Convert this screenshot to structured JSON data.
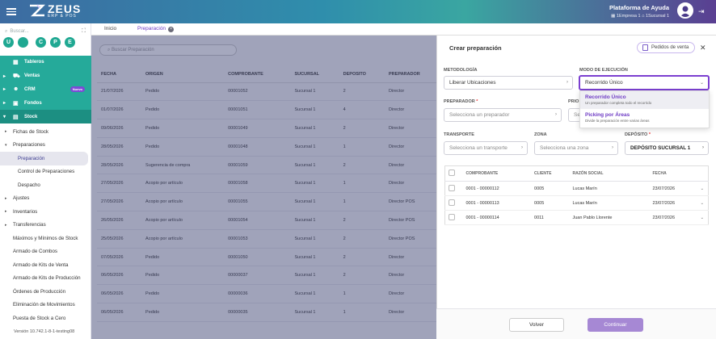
{
  "header": {
    "logo_title": "ZEUS",
    "logo_subtitle": "ERP & POS",
    "help_platform": "Plataforma de Ayuda",
    "company_info": "1Empresa 1",
    "branch_info": "1Sucursal 1"
  },
  "sidebar": {
    "search_placeholder": "Buscar...",
    "modules": [
      "U",
      "C",
      "P",
      "E"
    ],
    "top_items": [
      {
        "label": "Tableros",
        "icon": "grid-icon"
      },
      {
        "label": "Ventas",
        "icon": "cart-icon"
      },
      {
        "label": "CRM",
        "icon": "people-icon",
        "badge": "Nuevo"
      },
      {
        "label": "Fondos",
        "icon": "money-icon"
      },
      {
        "label": "Stock",
        "icon": "box-icon"
      }
    ],
    "stock_items": [
      {
        "label": "Fichas de Stock",
        "level": 1,
        "arrow": "▸"
      },
      {
        "label": "Preparaciones",
        "level": 1,
        "arrow": "▾"
      },
      {
        "label": "Preparación",
        "level": 2,
        "selected": true
      },
      {
        "label": "Control de Preparaciones",
        "level": 2
      },
      {
        "label": "Despacho",
        "level": 2
      },
      {
        "label": "Ajustes",
        "level": 1,
        "arrow": "▸"
      },
      {
        "label": "Inventarios",
        "level": 1,
        "arrow": "▸"
      },
      {
        "label": "Transferencias",
        "level": 1,
        "arrow": "▸"
      },
      {
        "label": "Máximos y Mínimos de Stock",
        "level": 1
      },
      {
        "label": "Armado de Combos",
        "level": 1
      },
      {
        "label": "Armado de Kits de Venta",
        "level": 1
      },
      {
        "label": "Armado de Kits de Producción",
        "level": 1
      },
      {
        "label": "Órdenes de Producción",
        "level": 1
      },
      {
        "label": "Eliminación de Movimientos",
        "level": 1
      },
      {
        "label": "Puesta de Stock a Cero",
        "level": 1
      }
    ],
    "version": "Versión 10.742.1-8-1-testing08"
  },
  "tabs": [
    {
      "label": "Inicio"
    },
    {
      "label": "Preparación",
      "active": true
    }
  ],
  "background_list": {
    "search_placeholder": "Buscar Preparación",
    "columns": [
      "FECHA",
      "ORIGEN",
      "COMPROBANTE",
      "SUCURSAL",
      "DEPOSITO",
      "PREPARADOR"
    ],
    "rows": [
      [
        "21/07/2026",
        "Pedido",
        "00001052",
        "Sucursal 1",
        "2",
        "Director"
      ],
      [
        "01/07/2026",
        "Pedido",
        "00001051",
        "Sucursal 1",
        "4",
        "Director"
      ],
      [
        "09/06/2026",
        "Pedido",
        "00001049",
        "Sucursal 1",
        "2",
        "Director"
      ],
      [
        "28/05/2026",
        "Pedido",
        "00001048",
        "Sucursal 1",
        "1",
        "Director"
      ],
      [
        "28/05/2026",
        "Sugerencia de compra",
        "00001059",
        "Sucursal 1",
        "2",
        "Director"
      ],
      [
        "27/05/2026",
        "Acopio por artículo",
        "00001058",
        "Sucursal 1",
        "1",
        "Director"
      ],
      [
        "27/05/2026",
        "Acopio por artículo",
        "00001055",
        "Sucursal 1",
        "1",
        "Director POS"
      ],
      [
        "26/05/2026",
        "Acopio por artículo",
        "00001054",
        "Sucursal 1",
        "2",
        "Director POS"
      ],
      [
        "25/05/2026",
        "Acopio por artículo",
        "00001053",
        "Sucursal 1",
        "2",
        "Director POS"
      ],
      [
        "07/05/2026",
        "Pedido",
        "00001050",
        "Sucursal 1",
        "2",
        "Director"
      ],
      [
        "06/05/2026",
        "Pedido",
        "00000037",
        "Sucursal 1",
        "2",
        "Director"
      ],
      [
        "06/05/2026",
        "Pedido",
        "00000036",
        "Sucursal 1",
        "1",
        "Director"
      ],
      [
        "06/05/2026",
        "Pedido",
        "00000035",
        "Sucursal 1",
        "1",
        "Director"
      ]
    ]
  },
  "panel": {
    "title": "Crear preparación",
    "orders_button": "Pedidos de venta",
    "metodologia_label": "METODOLOGÍA",
    "metodologia_value": "Liberar Ubicaciones",
    "modo_label": "MODO DE EJECUCIÓN",
    "modo_value": "Recorrido Único",
    "preparador_label": "PREPARADOR",
    "preparador_placeholder": "Selecciona un preparador",
    "prioridad_label": "PRIO",
    "prioridad_placeholder": "Sel",
    "transporte_label": "TRANSPORTE",
    "transporte_placeholder": "Selecciona un transporte",
    "zona_label": "ZONA",
    "zona_placeholder": "Selecciona una zona",
    "deposito_label": "DEPÓSITO",
    "deposito_value": "DEPÓSITO SUCURSAL 1",
    "dropdown_options": [
      {
        "title": "Recorrido Único",
        "desc": "Un preparador completa todo el recorrido"
      },
      {
        "title": "Picking por Áreas",
        "desc": "Divide la preparación entre varias áreas"
      }
    ],
    "table_columns": [
      "COMPROBANTE",
      "CLIENTE",
      "RAZÓN SOCIAL",
      "FECHA"
    ],
    "table_rows": [
      [
        "0001 - 00000112",
        "0005",
        "Lucas Marín",
        "23/07/2026"
      ],
      [
        "0001 - 00000113",
        "0005",
        "Lucas Marín",
        "23/07/2026"
      ],
      [
        "0001 - 00000114",
        "0011",
        "Juan Pablo Llorente",
        "23/07/2026"
      ]
    ],
    "back_button": "Volver",
    "continue_button": "Continuar"
  },
  "colors": {
    "accent": "#7b3fd0",
    "teal": "#25aa9a",
    "continue": "#a688d4"
  }
}
